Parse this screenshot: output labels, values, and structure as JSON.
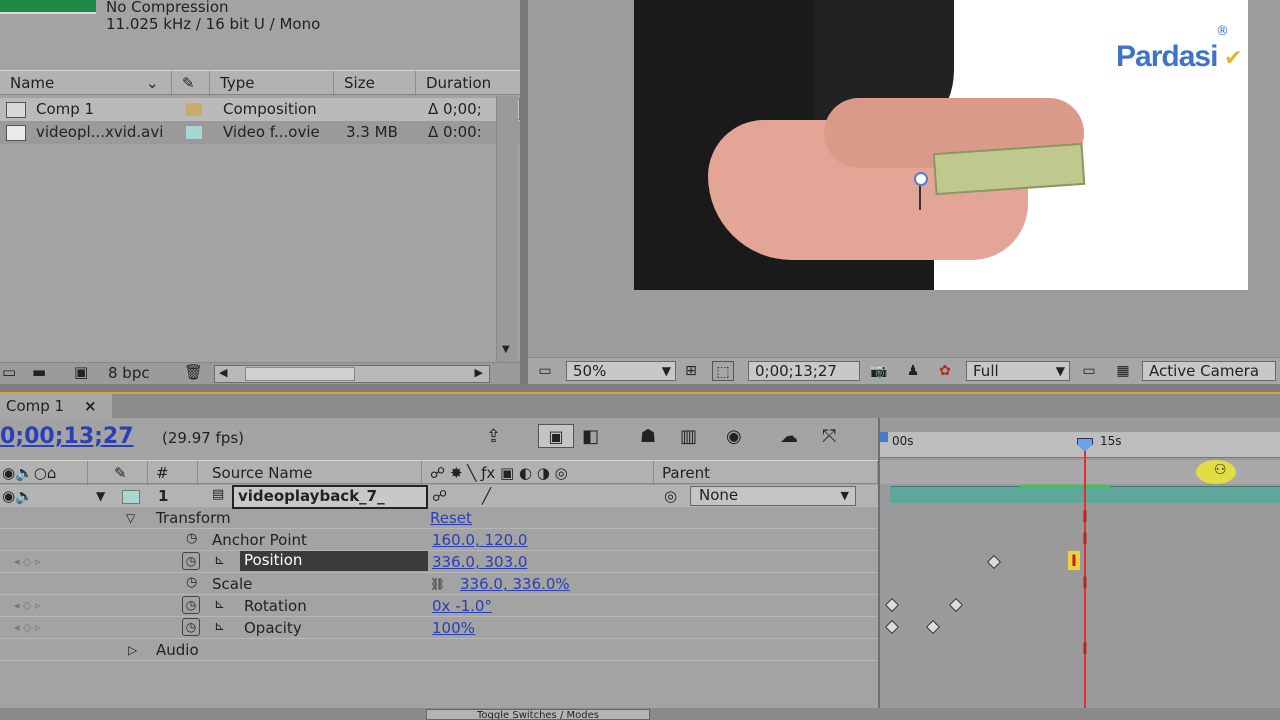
{
  "project": {
    "info_compression": "No Compression",
    "info_audio": "11.025 kHz / 16 bit U / Mono",
    "columns": {
      "name": "Name",
      "type": "Type",
      "size": "Size",
      "duration": "Duration"
    },
    "items": [
      {
        "name": "Comp 1",
        "type": "Composition",
        "size": "",
        "duration": "Δ 0;00;",
        "swatch": "#c9ac6a",
        "icon": "composition-icon"
      },
      {
        "name": "videopl...xvid.avi",
        "type": "Video f...ovie",
        "size": "3.3 MB",
        "duration": "Δ 0:00:",
        "swatch": "#a9d6d0",
        "icon": "footage-icon"
      }
    ],
    "bpc": "8 bpc"
  },
  "viewer": {
    "zoom": "50%",
    "timecode": "0;00;13;27",
    "resolution": "Full",
    "camera": "Active Camera",
    "watermark": "Pardasi"
  },
  "timeline": {
    "tab_label": "Comp 1",
    "tab_close": "×",
    "current_time": "0;00;13;27",
    "fps": "(29.97 fps)",
    "col_hash": "#",
    "col_source": "Source Name",
    "col_parent": "Parent",
    "ruler_start": "00s",
    "ruler_mark": "15s",
    "layer": {
      "index": "1",
      "name": "videoplayback_7_",
      "parent": "None"
    },
    "transform_label": "Transform",
    "reset_label": "Reset",
    "properties": [
      {
        "name": "Anchor Point",
        "value": "160.0, 120.0"
      },
      {
        "name": "Position",
        "value": "336.0, 303.0"
      },
      {
        "name": "Scale",
        "value": "336.0, 336.0%"
      },
      {
        "name": "Rotation",
        "value": "0x -1.0°"
      },
      {
        "name": "Opacity",
        "value": "100%"
      }
    ],
    "audio_label": "Audio",
    "bottom_button": "Toggle Switches / Modes"
  },
  "colors": {
    "accent_orange": "#d4a93a",
    "time_blue": "#2a3fb8",
    "cti_red": "#e03030",
    "layer_bar": "#5fa79a"
  }
}
